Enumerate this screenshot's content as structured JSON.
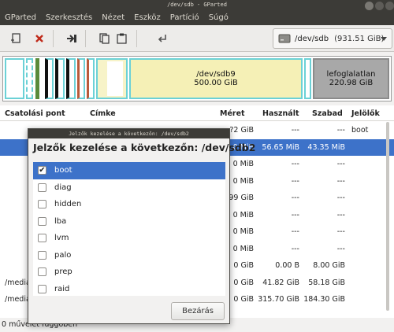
{
  "window": {
    "title": "/dev/sdb - GParted"
  },
  "menubar": [
    "GParted",
    "Szerkesztés",
    "Nézet",
    "Eszköz",
    "Partíció",
    "Súgó"
  ],
  "device_selector": {
    "name": "/dev/sdb",
    "size": "(931.51 GiB)"
  },
  "graph": {
    "sdb9": {
      "name": "/dev/sdb9",
      "size": "500.00 GiB"
    },
    "unallocated": {
      "name": "lefoglalatlan",
      "size": "220.98 GiB"
    }
  },
  "table": {
    "headers": [
      "Csatolási pont",
      "Címke",
      "Méret",
      "Használt",
      "Szabad",
      "Jelölők"
    ],
    "rows": [
      {
        "mount": "",
        "size": "?2 GiB",
        "used": "---",
        "free": "---",
        "flags": "boot"
      },
      {
        "mount": "",
        "size": "0 MiB",
        "used": "56.65 MiB",
        "free": "43.35 MiB",
        "flags": ""
      },
      {
        "mount": "",
        "size": "0 MiB",
        "used": "---",
        "free": "---",
        "flags": ""
      },
      {
        "mount": "",
        "size": "0 MiB",
        "used": "---",
        "free": "---",
        "flags": ""
      },
      {
        "mount": "",
        "size": "99 GiB",
        "used": "---",
        "free": "---",
        "flags": ""
      },
      {
        "mount": "",
        "size": "0 MiB",
        "used": "---",
        "free": "---",
        "flags": ""
      },
      {
        "mount": "",
        "size": "0 MiB",
        "used": "---",
        "free": "---",
        "flags": ""
      },
      {
        "mount": "",
        "size": "0 MiB",
        "used": "---",
        "free": "---",
        "flags": ""
      },
      {
        "mount": "",
        "size": "0 GiB",
        "used": "0.00 B",
        "free": "8.00 GiB",
        "flags": ""
      },
      {
        "mount": "/media",
        "size": "0 GiB",
        "used": "41.82 GiB",
        "free": "58.18 GiB",
        "flags": ""
      },
      {
        "mount": "/media",
        "size": "0 GiB",
        "used": "315.70 GiB",
        "free": "184.30 GiB",
        "flags": ""
      }
    ]
  },
  "status": {
    "pending": "0 művelet függőben"
  },
  "dialog": {
    "title": "Jelzők kezelése a következőn: /dev/sdb2",
    "heading": "Jelzők kezelése a következőn: /dev/sdb2",
    "flags": [
      {
        "label": "boot",
        "checked": true
      },
      {
        "label": "diag",
        "checked": false
      },
      {
        "label": "hidden",
        "checked": false
      },
      {
        "label": "lba",
        "checked": false
      },
      {
        "label": "lvm",
        "checked": false
      },
      {
        "label": "palo",
        "checked": false
      },
      {
        "label": "prep",
        "checked": false
      },
      {
        "label": "raid",
        "checked": false
      }
    ],
    "close_label": "Bezárás"
  }
}
